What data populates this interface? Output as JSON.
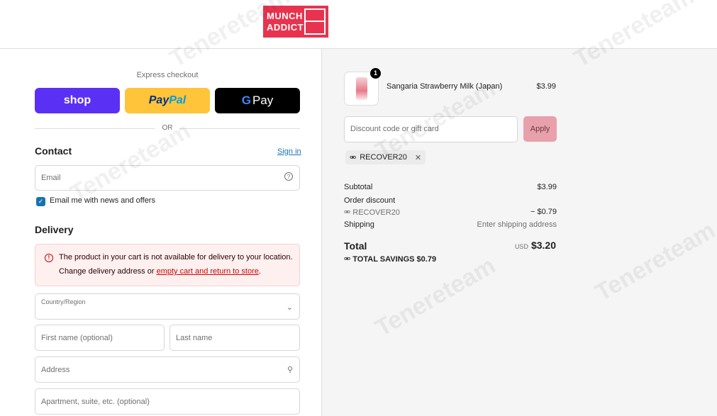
{
  "header": {
    "logo_line1": "MUNCH",
    "logo_line2": "ADDICT"
  },
  "express": {
    "label": "Express checkout",
    "shop_label": "shop",
    "paypal_part1": "Pay",
    "paypal_part2": "Pal",
    "gpay_g": "G",
    "gpay_label": "Pay",
    "or_label": "OR"
  },
  "contact": {
    "title": "Contact",
    "signin_label": "Sign in",
    "email_placeholder": "Email",
    "newsletter_checked": true,
    "newsletter_label": "Email me with news and offers"
  },
  "delivery": {
    "title": "Delivery",
    "alert_line1": "The product in your cart is not available for delivery to your location.",
    "alert_line2_prefix": "Change delivery address or ",
    "alert_link": "empty cart and return to store",
    "alert_line2_suffix": ".",
    "country_label": "Country/Region",
    "first_name_placeholder": "First name (optional)",
    "last_name_placeholder": "Last name",
    "address_placeholder": "Address",
    "apartment_placeholder": "Apartment, suite, etc. (optional)"
  },
  "summary": {
    "quantity": "1",
    "product_name": "Sangaria Strawberry Milk (Japan)",
    "product_price": "$3.99",
    "discount_placeholder": "Discount code or gift card",
    "apply_label": "Apply",
    "applied_code": "RECOVER20",
    "subtotal_label": "Subtotal",
    "subtotal_value": "$3.99",
    "order_discount_label": "Order discount",
    "discount_code": "RECOVER20",
    "discount_value": "− $0.79",
    "shipping_label": "Shipping",
    "shipping_value": "Enter shipping address",
    "total_label": "Total",
    "currency": "USD",
    "total_value": "$3.20",
    "savings_label": "TOTAL SAVINGS",
    "savings_value": "$0.79"
  },
  "watermark": "Tenereteam",
  "colors": {
    "shop": "#5a31f4",
    "paypal": "#ffc439",
    "gpay": "#000000",
    "brand": "#e8334f",
    "link": "#1773b0",
    "alert_bg": "#fff0f0"
  }
}
